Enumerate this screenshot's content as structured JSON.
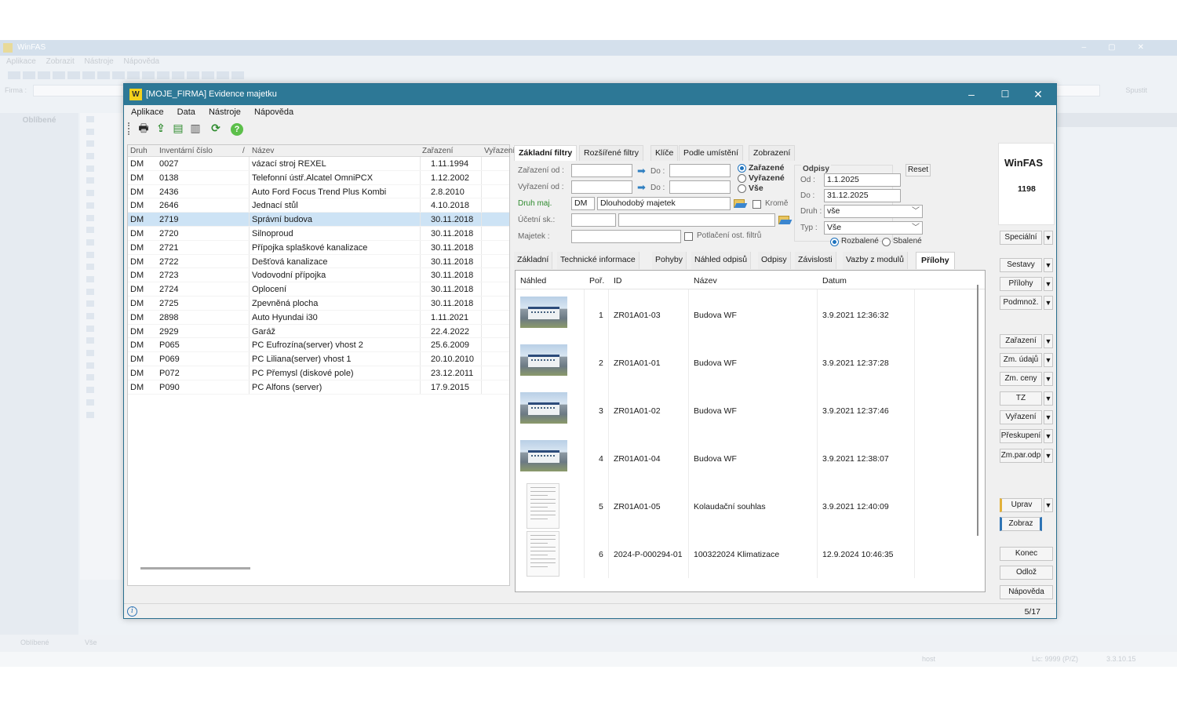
{
  "background_app": {
    "title": "WinFAS",
    "menu": [
      "Aplikace",
      "Zobrazit",
      "Nástroje",
      "Nápověda"
    ],
    "firm_label": "Firma :",
    "run_label": "Spustit",
    "left_panel_title": "Oblíbené",
    "bottom_tabs": [
      "Oblíbené",
      "Vše"
    ],
    "status": {
      "user": "host",
      "license": "Lic: 9999 (P/Z)",
      "version": "3.3.10.15"
    }
  },
  "window": {
    "logo": "W",
    "title": "[MOJE_FIRMA] Evidence majetku",
    "menu": [
      "Aplikace",
      "Data",
      "Nástroje",
      "Nápověda"
    ],
    "toolbar_icons": [
      "print-icon",
      "export-icon",
      "list-icon",
      "copy-icon",
      "refresh-icon",
      "help-icon"
    ]
  },
  "grid": {
    "columns": [
      "Druh",
      "Inventární číslo",
      "/",
      "Název",
      "Zařazení",
      "Vyřazení"
    ],
    "rows": [
      {
        "druh": "DM",
        "cislo": "0027",
        "nazev": "vázací stroj REXEL",
        "zarazeni": "1.11.1994"
      },
      {
        "druh": "DM",
        "cislo": "0138",
        "nazev": "Telefonní ústř.Alcatel OmniPCX",
        "zarazeni": "1.12.2002"
      },
      {
        "druh": "DM",
        "cislo": "2436",
        "nazev": "Auto Ford Focus Trend Plus Kombi",
        "zarazeni": "2.8.2010"
      },
      {
        "druh": "DM",
        "cislo": "2646",
        "nazev": "Jednací stůl",
        "zarazeni": "4.10.2018"
      },
      {
        "druh": "DM",
        "cislo": "2719",
        "nazev": "Správní budova",
        "zarazeni": "30.11.2018",
        "selected": true
      },
      {
        "druh": "DM",
        "cislo": "2720",
        "nazev": "Silnoproud",
        "zarazeni": "30.11.2018"
      },
      {
        "druh": "DM",
        "cislo": "2721",
        "nazev": "Přípojka splaškové kanalizace",
        "zarazeni": "30.11.2018"
      },
      {
        "druh": "DM",
        "cislo": "2722",
        "nazev": "Dešťová kanalizace",
        "zarazeni": "30.11.2018"
      },
      {
        "druh": "DM",
        "cislo": "2723",
        "nazev": "Vodovodní přípojka",
        "zarazeni": "30.11.2018"
      },
      {
        "druh": "DM",
        "cislo": "2724",
        "nazev": "Oplocení",
        "zarazeni": "30.11.2018"
      },
      {
        "druh": "DM",
        "cislo": "2725",
        "nazev": "Zpevněná plocha",
        "zarazeni": "30.11.2018"
      },
      {
        "druh": "DM",
        "cislo": "2898",
        "nazev": "Auto Hyundai i30",
        "zarazeni": "1.11.2021"
      },
      {
        "druh": "DM",
        "cislo": "2929",
        "nazev": "Garáž",
        "zarazeni": "22.4.2022"
      },
      {
        "druh": "DM",
        "cislo": "P065",
        "nazev": "PC Eufrozína(server) vhost 2",
        "zarazeni": "25.6.2009"
      },
      {
        "druh": "DM",
        "cislo": "P069",
        "nazev": "PC Liliana(server) vhost 1",
        "zarazeni": "20.10.2010"
      },
      {
        "druh": "DM",
        "cislo": "P072",
        "nazev": "PC Přemysl (diskové pole)",
        "zarazeni": "23.12.2011"
      },
      {
        "druh": "DM",
        "cislo": "P090",
        "nazev": "PC Alfons (server)",
        "zarazeni": "17.9.2015"
      }
    ]
  },
  "filter_tabs": [
    "Základní filtry",
    "Rozšířené filtry",
    "Klíče",
    "Podle umístění",
    "Zobrazení"
  ],
  "filters": {
    "zarazeni_od": "Zařazení od :",
    "vyrazeni_od": "Vyřazení od :",
    "do": "Do :",
    "druh_maj_label": "Druh maj.",
    "druh_maj_code": "DM",
    "druh_maj_name": "Dlouhodobý majetek",
    "krome": "Kromě",
    "ucetni_sk": "Účetní sk.:",
    "majetek": "Majetek :",
    "potlaceni": "Potlačení ost. filtrů",
    "radio": [
      "Zařazené",
      "Vyřazené",
      "Vše"
    ],
    "odpisy_title": "Odpisy",
    "reset": "Reset",
    "od_label": "Od :",
    "od_value": "1.1.2025",
    "do_label": "Do :",
    "do_value": "31.12.2025",
    "druh_label": "Druh :",
    "druh_value": "vše",
    "typ_label": "Typ :",
    "typ_value": "Vše",
    "rozbalene": "Rozbalené",
    "sbalene": "Sbalené"
  },
  "detail_tabs": [
    "Základní",
    "Technické informace",
    "Pohyby",
    "Náhled odpisů",
    "Odpisy",
    "Závislosti",
    "Vazby z modulů",
    "Přílohy"
  ],
  "attachments": {
    "columns": [
      "Náhled",
      "Poř.",
      "ID",
      "Název",
      "Datum"
    ],
    "rows": [
      {
        "por": "1",
        "id": "ZR01A01-03",
        "nazev": "Budova WF",
        "datum": "3.9.2021 12:36:32",
        "thumb": "photo"
      },
      {
        "por": "2",
        "id": "ZR01A01-01",
        "nazev": "Budova WF",
        "datum": "3.9.2021 12:37:28",
        "thumb": "photo"
      },
      {
        "por": "3",
        "id": "ZR01A01-02",
        "nazev": "Budova WF",
        "datum": "3.9.2021 12:37:46",
        "thumb": "photo"
      },
      {
        "por": "4",
        "id": "ZR01A01-04",
        "nazev": "Budova WF",
        "datum": "3.9.2021 12:38:07",
        "thumb": "photo"
      },
      {
        "por": "5",
        "id": "ZR01A01-05",
        "nazev": "Kolaudační souhlas",
        "datum": "3.9.2021 12:40:09",
        "thumb": "doc"
      },
      {
        "por": "6",
        "id": "2024-P-000294-01",
        "nazev": "100322024 Klimatizace",
        "datum": "12.9.2024 10:46:35",
        "thumb": "doc"
      }
    ]
  },
  "right_panel": {
    "logo": "WinFAS",
    "number": "1198",
    "buttons": [
      "Speciální",
      "Sestavy",
      "Přílohy",
      "Podmnož.",
      "Zařazení",
      "Zm. údajů",
      "Zm. ceny",
      "TZ",
      "Vyřazení",
      "Přeskupení",
      "Zm.par.odp",
      "Uprav",
      "Zobraz",
      "Konec",
      "Odlož",
      "Nápověda"
    ]
  },
  "status": {
    "page": "5/17",
    "info": "i"
  }
}
